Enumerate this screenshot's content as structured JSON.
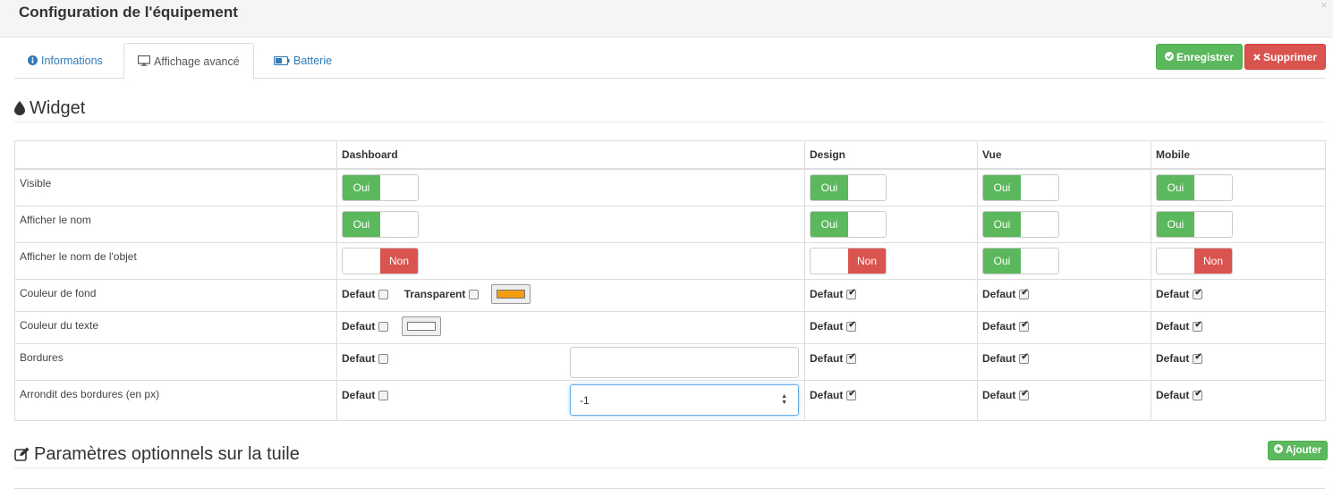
{
  "header": {
    "title": "Configuration de l'équipement",
    "close_label": "×"
  },
  "tabs": [
    {
      "label": "Informations",
      "icon": "info-circle-icon"
    },
    {
      "label": "Affichage avancé",
      "icon": "desktop-icon"
    },
    {
      "label": "Batterie",
      "icon": "battery-icon"
    }
  ],
  "actions": {
    "save_label": "Enregistrer",
    "delete_label": "Supprimer",
    "add_label": "Ajouter"
  },
  "widget_section": {
    "title": "Widget"
  },
  "widget_table": {
    "columns": [
      "",
      "Dashboard",
      "Design",
      "Vue",
      "Mobile"
    ],
    "rows": [
      {
        "label": "Visible"
      },
      {
        "label": "Afficher le nom"
      },
      {
        "label": "Afficher le nom de l'objet"
      },
      {
        "label": "Couleur de fond"
      },
      {
        "label": "Couleur du texte"
      },
      {
        "label": "Bordures"
      },
      {
        "label": "Arrondit des bordures (en px)"
      }
    ],
    "on_label": "Oui",
    "off_label": "Non",
    "default_label": "Defaut",
    "transparent_label": "Transparent",
    "radius_value": "-1"
  },
  "optional_section": {
    "title": "Paramètres optionnels sur la tuile"
  },
  "colors": {
    "success": "#5cb85c",
    "danger": "#d9534f",
    "link": "#337ab7",
    "bg_swatch": "#f39c12"
  }
}
